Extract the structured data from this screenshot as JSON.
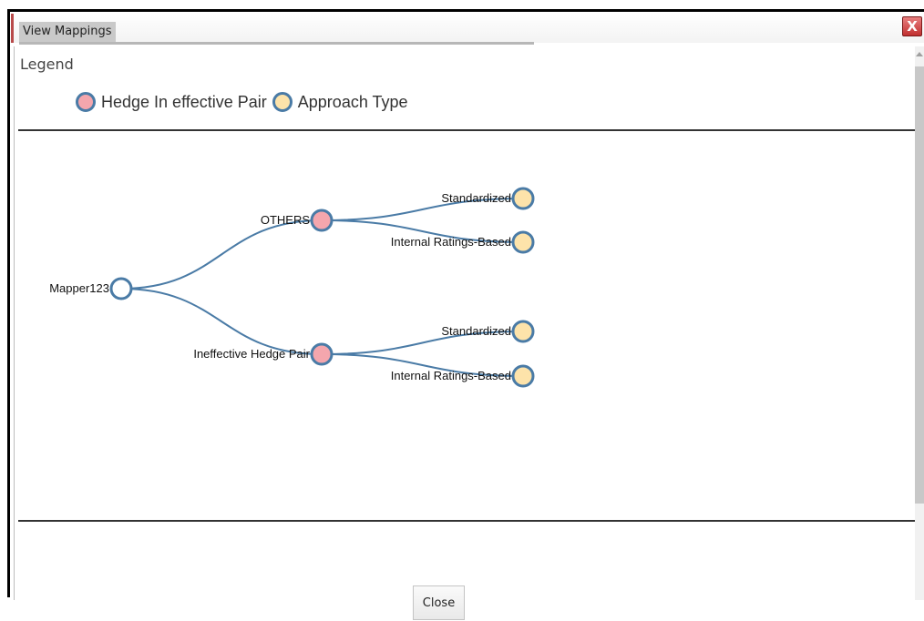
{
  "window": {
    "title": "View Mappings",
    "close_glyph": "X"
  },
  "legend": {
    "title": "Legend",
    "items": [
      {
        "label": "Hedge In effective Pair",
        "color": "#f4a6ad"
      },
      {
        "label": "Approach Type",
        "color": "#fde3aa"
      }
    ]
  },
  "tree": {
    "link_color": "#4a7ba6",
    "node_stroke": "#4a7ba6",
    "root": {
      "label": "Mapper123",
      "color": "#ffffff"
    },
    "branches": [
      {
        "label": "OTHERS",
        "color": "#f4a6ad",
        "children": [
          {
            "label": "Standardized",
            "color": "#fde3aa"
          },
          {
            "label": "Internal Ratings-Based",
            "color": "#fde3aa"
          }
        ]
      },
      {
        "label": "Ineffective Hedge Pair",
        "color": "#f4a6ad",
        "children": [
          {
            "label": "Standardized",
            "color": "#fde3aa"
          },
          {
            "label": "Internal Ratings-Based",
            "color": "#fde3aa"
          }
        ]
      }
    ]
  },
  "footer": {
    "close_label": "Close"
  }
}
